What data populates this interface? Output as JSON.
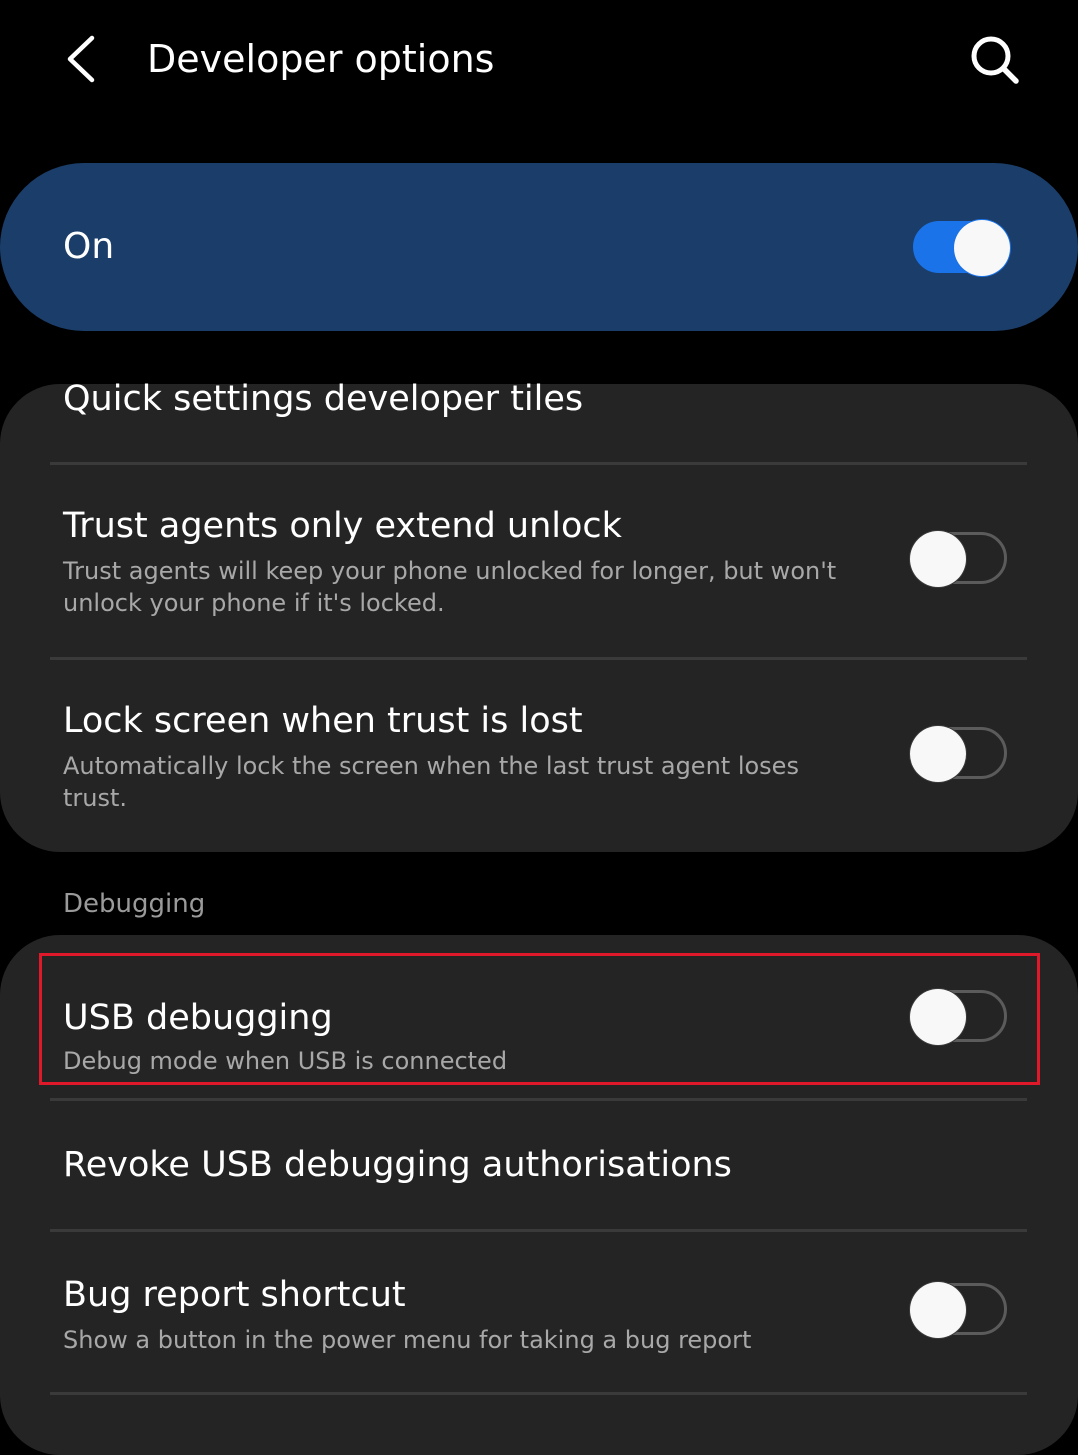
{
  "header": {
    "back_icon": "chevron-left-icon",
    "title": "Developer options",
    "search_icon": "search-icon"
  },
  "master_switch": {
    "label": "On",
    "enabled": true,
    "accent_color": "#1a73e8",
    "card_color": "#1b3d6a"
  },
  "settings_group_1": {
    "items": [
      {
        "title": "Quick settings developer tiles"
      },
      {
        "title": "Trust agents only extend unlock",
        "subtitle": "Trust agents will keep your phone unlocked for longer, but won't unlock your phone if it's locked.",
        "enabled": false
      },
      {
        "title": "Lock screen when trust is lost",
        "subtitle": "Automatically lock the screen when the last trust agent loses trust.",
        "enabled": false
      }
    ]
  },
  "debugging_section": {
    "header": "Debugging",
    "items": [
      {
        "title": "USB debugging",
        "subtitle": "Debug mode when USB is connected",
        "enabled": false,
        "highlighted": true,
        "highlight_color": "#e0192a"
      },
      {
        "title": "Revoke USB debugging authorisations"
      },
      {
        "title": "Bug report shortcut",
        "subtitle": "Show a button in the power menu for taking a bug report",
        "enabled": false
      }
    ]
  }
}
